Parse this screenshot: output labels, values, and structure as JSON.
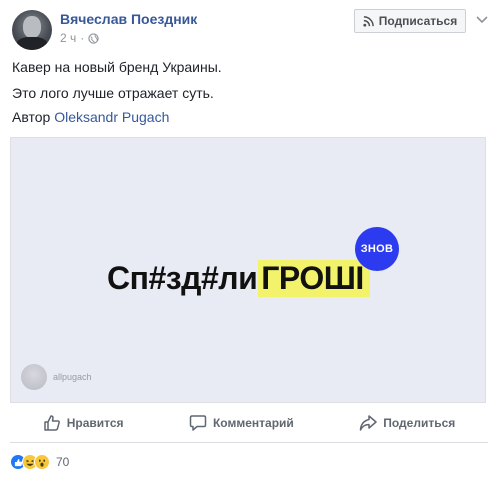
{
  "post": {
    "author": "Вячеслав Поездник",
    "time": "2 ч",
    "follow_label": "Подписаться",
    "lines": [
      "Кавер на новый бренд Украины.",
      "Это лого лучше отражает суть."
    ],
    "credit_prefix": "Автор",
    "credit_link": "Oleksandr Pugach"
  },
  "image": {
    "logo_left": "Сп#зд#ли",
    "logo_right": "ГРОШІ",
    "badge": "ЗНОВ",
    "watermark": "allpugach",
    "colors": {
      "background": "#e8eaf4",
      "highlight": "#f2f36a",
      "badge": "#2d3bf0"
    }
  },
  "actions": {
    "like": "Нравится",
    "comment": "Комментарий",
    "share": "Поделиться"
  },
  "reactions": {
    "count": "70",
    "icons": [
      "like-icon",
      "haha-icon",
      "wow-icon"
    ]
  }
}
